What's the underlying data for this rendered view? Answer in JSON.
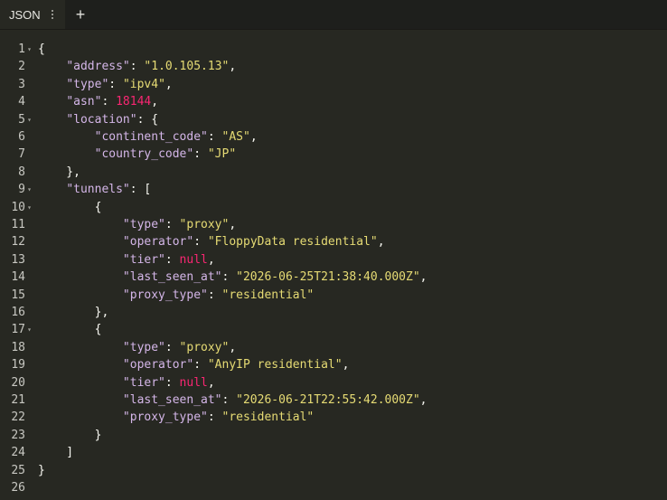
{
  "tab": {
    "label": "JSON",
    "menu_icon": "vertical-ellipsis-icon",
    "add_icon": "plus-icon",
    "add_label": "+"
  },
  "gutter": {
    "fold_icon": "caret-down-icon",
    "fold_glyph": "▾",
    "lines": [
      "1",
      "2",
      "3",
      "4",
      "5",
      "6",
      "7",
      "8",
      "9",
      "10",
      "11",
      "12",
      "13",
      "14",
      "15",
      "16",
      "17",
      "18",
      "19",
      "20",
      "21",
      "22",
      "23",
      "24",
      "25",
      "26"
    ],
    "foldable_lines": [
      1,
      5,
      9,
      10,
      17
    ]
  },
  "code": {
    "lines": [
      [
        {
          "t": "p",
          "v": "{"
        }
      ],
      [
        {
          "t": "p",
          "v": "    "
        },
        {
          "t": "k",
          "v": "\"address\""
        },
        {
          "t": "p",
          "v": ": "
        },
        {
          "t": "s",
          "v": "\"1.0.105.13\""
        },
        {
          "t": "p",
          "v": ","
        }
      ],
      [
        {
          "t": "p",
          "v": "    "
        },
        {
          "t": "k",
          "v": "\"type\""
        },
        {
          "t": "p",
          "v": ": "
        },
        {
          "t": "s",
          "v": "\"ipv4\""
        },
        {
          "t": "p",
          "v": ","
        }
      ],
      [
        {
          "t": "p",
          "v": "    "
        },
        {
          "t": "k",
          "v": "\"asn\""
        },
        {
          "t": "p",
          "v": ": "
        },
        {
          "t": "n",
          "v": "18144"
        },
        {
          "t": "p",
          "v": ","
        }
      ],
      [
        {
          "t": "p",
          "v": "    "
        },
        {
          "t": "k",
          "v": "\"location\""
        },
        {
          "t": "p",
          "v": ": {"
        }
      ],
      [
        {
          "t": "p",
          "v": "        "
        },
        {
          "t": "k",
          "v": "\"continent_code\""
        },
        {
          "t": "p",
          "v": ": "
        },
        {
          "t": "s",
          "v": "\"AS\""
        },
        {
          "t": "p",
          "v": ","
        }
      ],
      [
        {
          "t": "p",
          "v": "        "
        },
        {
          "t": "k",
          "v": "\"country_code\""
        },
        {
          "t": "p",
          "v": ": "
        },
        {
          "t": "s",
          "v": "\"JP\""
        }
      ],
      [
        {
          "t": "p",
          "v": "    },"
        }
      ],
      [
        {
          "t": "p",
          "v": "    "
        },
        {
          "t": "k",
          "v": "\"tunnels\""
        },
        {
          "t": "p",
          "v": ": ["
        }
      ],
      [
        {
          "t": "p",
          "v": "        {"
        }
      ],
      [
        {
          "t": "p",
          "v": "            "
        },
        {
          "t": "k",
          "v": "\"type\""
        },
        {
          "t": "p",
          "v": ": "
        },
        {
          "t": "s",
          "v": "\"proxy\""
        },
        {
          "t": "p",
          "v": ","
        }
      ],
      [
        {
          "t": "p",
          "v": "            "
        },
        {
          "t": "k",
          "v": "\"operator\""
        },
        {
          "t": "p",
          "v": ": "
        },
        {
          "t": "s",
          "v": "\"FloppyData residential\""
        },
        {
          "t": "p",
          "v": ","
        }
      ],
      [
        {
          "t": "p",
          "v": "            "
        },
        {
          "t": "k",
          "v": "\"tier\""
        },
        {
          "t": "p",
          "v": ": "
        },
        {
          "t": "nl",
          "v": "null"
        },
        {
          "t": "p",
          "v": ","
        }
      ],
      [
        {
          "t": "p",
          "v": "            "
        },
        {
          "t": "k",
          "v": "\"last_seen_at\""
        },
        {
          "t": "p",
          "v": ": "
        },
        {
          "t": "s",
          "v": "\"2026-06-25T21:38:40.000Z\""
        },
        {
          "t": "p",
          "v": ","
        }
      ],
      [
        {
          "t": "p",
          "v": "            "
        },
        {
          "t": "k",
          "v": "\"proxy_type\""
        },
        {
          "t": "p",
          "v": ": "
        },
        {
          "t": "s",
          "v": "\"residential\""
        }
      ],
      [
        {
          "t": "p",
          "v": "        },"
        }
      ],
      [
        {
          "t": "p",
          "v": "        {"
        }
      ],
      [
        {
          "t": "p",
          "v": "            "
        },
        {
          "t": "k",
          "v": "\"type\""
        },
        {
          "t": "p",
          "v": ": "
        },
        {
          "t": "s",
          "v": "\"proxy\""
        },
        {
          "t": "p",
          "v": ","
        }
      ],
      [
        {
          "t": "p",
          "v": "            "
        },
        {
          "t": "k",
          "v": "\"operator\""
        },
        {
          "t": "p",
          "v": ": "
        },
        {
          "t": "s",
          "v": "\"AnyIP residential\""
        },
        {
          "t": "p",
          "v": ","
        }
      ],
      [
        {
          "t": "p",
          "v": "            "
        },
        {
          "t": "k",
          "v": "\"tier\""
        },
        {
          "t": "p",
          "v": ": "
        },
        {
          "t": "nl",
          "v": "null"
        },
        {
          "t": "p",
          "v": ","
        }
      ],
      [
        {
          "t": "p",
          "v": "            "
        },
        {
          "t": "k",
          "v": "\"last_seen_at\""
        },
        {
          "t": "p",
          "v": ": "
        },
        {
          "t": "s",
          "v": "\"2026-06-21T22:55:42.000Z\""
        },
        {
          "t": "p",
          "v": ","
        }
      ],
      [
        {
          "t": "p",
          "v": "            "
        },
        {
          "t": "k",
          "v": "\"proxy_type\""
        },
        {
          "t": "p",
          "v": ": "
        },
        {
          "t": "s",
          "v": "\"residential\""
        }
      ],
      [
        {
          "t": "p",
          "v": "        }"
        }
      ],
      [
        {
          "t": "p",
          "v": "    ]"
        }
      ],
      [
        {
          "t": "p",
          "v": "}"
        }
      ],
      []
    ]
  },
  "colors": {
    "background": "#272822",
    "tabbar": "#1e1f1c",
    "key": "#d4b6e8",
    "string": "#e6db74",
    "number": "#f92672",
    "null": "#f92672",
    "punctuation": "#f8f8f2",
    "line_number": "#c8c8c2"
  }
}
